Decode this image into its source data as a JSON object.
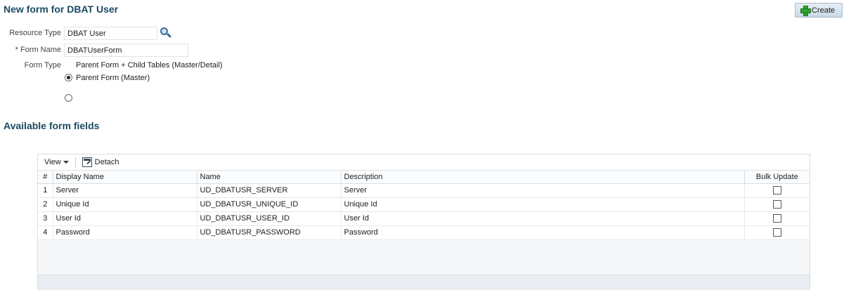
{
  "header": {
    "title": "New form for DBAT User",
    "create_label": "Create"
  },
  "form": {
    "resource_type_label": "Resource Type",
    "resource_type_value": "DBAT User",
    "required_marker": "*",
    "form_name_label": "Form Name",
    "form_name_value": "DBATUserForm",
    "form_type_label": "Form Type",
    "form_type_options": [
      {
        "label": "Parent Form + Child Tables (Master/Detail)",
        "selected": true
      },
      {
        "label": "Parent Form (Master)",
        "selected": false
      }
    ]
  },
  "fields_section": {
    "title": "Available form fields",
    "toolbar": {
      "view_label": "View",
      "detach_label": "Detach"
    },
    "columns": [
      "#",
      "Display Name",
      "Name",
      "Description",
      "Bulk Update"
    ],
    "rows": [
      {
        "num": "1",
        "display": "Server",
        "name": "UD_DBATUSR_SERVER",
        "desc": "Server",
        "bulk": false
      },
      {
        "num": "2",
        "display": "Unique Id",
        "name": "UD_DBATUSR_UNIQUE_ID",
        "desc": "Unique Id",
        "bulk": false
      },
      {
        "num": "3",
        "display": "User Id",
        "name": "UD_DBATUSR_USER_ID",
        "desc": "User Id",
        "bulk": false
      },
      {
        "num": "4",
        "display": "Password",
        "name": "UD_DBATUSR_PASSWORD",
        "desc": "Password",
        "bulk": false
      }
    ]
  },
  "icons": {
    "create": "plus-icon",
    "lookup": "search-icon",
    "view_menu": "chevron-down-icon",
    "detach": "detach-icon"
  },
  "colors": {
    "title": "#1b4a63",
    "create_button": "#c9d9e7",
    "plus": "#2fa12f"
  }
}
